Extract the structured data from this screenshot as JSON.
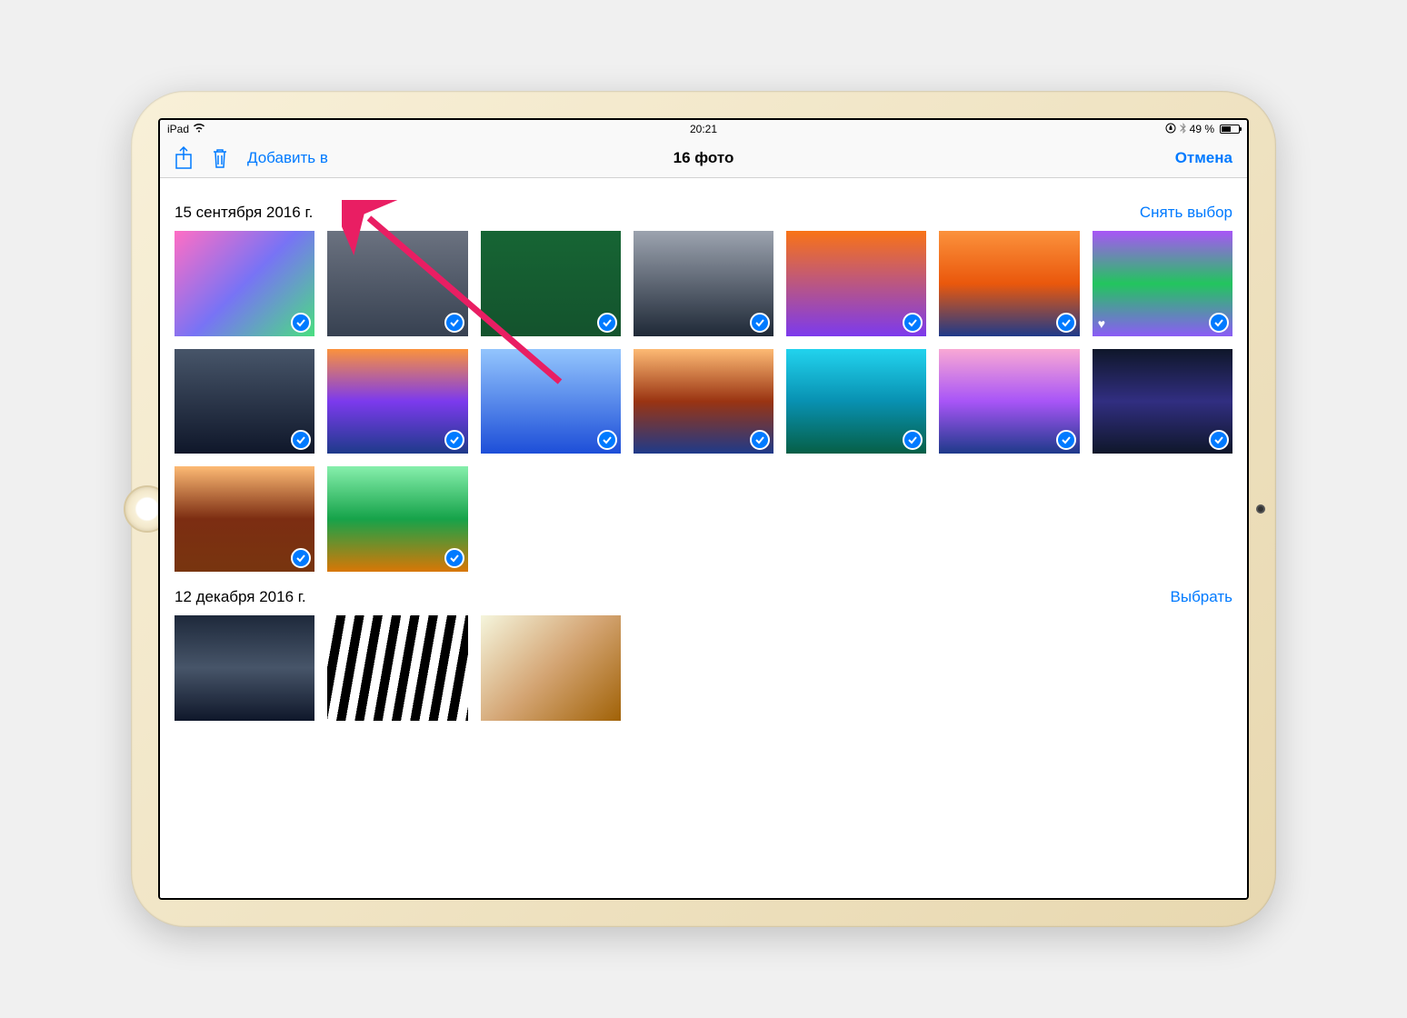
{
  "status": {
    "device": "iPad",
    "time": "20:21",
    "battery_pct": "49 %"
  },
  "nav": {
    "add_to": "Добавить в",
    "title": "16 фото",
    "cancel": "Отмена"
  },
  "sections": [
    {
      "title": "15 сентября 2016 г.",
      "action": "Снять выбор",
      "photos": [
        {
          "cls": "g1",
          "selected": true,
          "fav": false
        },
        {
          "cls": "g2",
          "selected": true,
          "fav": false
        },
        {
          "cls": "g3",
          "selected": true,
          "fav": false
        },
        {
          "cls": "g4",
          "selected": true,
          "fav": false
        },
        {
          "cls": "g5",
          "selected": true,
          "fav": false
        },
        {
          "cls": "g6",
          "selected": true,
          "fav": false
        },
        {
          "cls": "g7",
          "selected": true,
          "fav": true
        },
        {
          "cls": "g8",
          "selected": true,
          "fav": false
        },
        {
          "cls": "g9",
          "selected": true,
          "fav": false
        },
        {
          "cls": "g10",
          "selected": true,
          "fav": false
        },
        {
          "cls": "g11",
          "selected": true,
          "fav": false
        },
        {
          "cls": "g12",
          "selected": true,
          "fav": false
        },
        {
          "cls": "g13",
          "selected": true,
          "fav": false
        },
        {
          "cls": "g14",
          "selected": true,
          "fav": false
        },
        {
          "cls": "g15",
          "selected": true,
          "fav": false
        },
        {
          "cls": "g16",
          "selected": true,
          "fav": false
        }
      ]
    },
    {
      "title": "12 декабря 2016 г.",
      "action": "Выбрать",
      "photos": [
        {
          "cls": "g17",
          "selected": false,
          "fav": false
        },
        {
          "cls": "g18",
          "selected": false,
          "fav": false
        },
        {
          "cls": "g19",
          "selected": false,
          "fav": false
        }
      ]
    }
  ]
}
